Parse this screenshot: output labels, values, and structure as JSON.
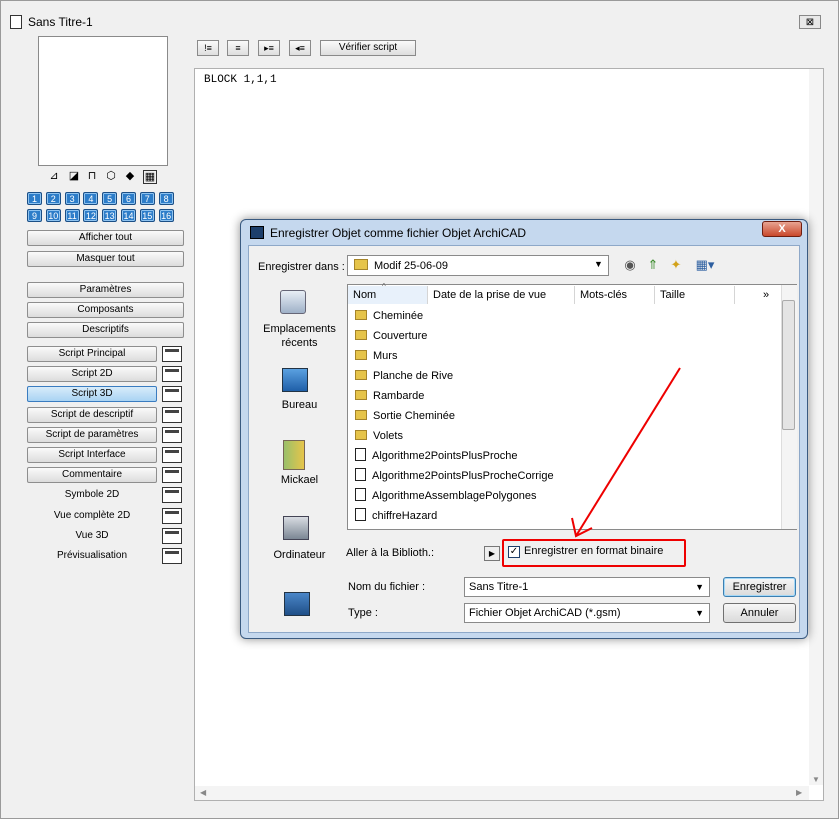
{
  "window": {
    "title": "Sans Titre-1",
    "close_label": "⊠"
  },
  "left_panel": {
    "view_icons": [
      "iso-view-icon",
      "plan-view-icon",
      "section-view-icon",
      "axo-view-icon",
      "perspective-view-icon",
      "film-view-icon"
    ],
    "number_buttons_row1": [
      "1",
      "2",
      "3",
      "4",
      "5",
      "6",
      "7",
      "8"
    ],
    "number_buttons_row2": [
      "9",
      "10",
      "11",
      "12",
      "13",
      "14",
      "15",
      "16"
    ],
    "show_all": "Afficher tout",
    "hide_all": "Masquer  tout",
    "params": "Paramètres",
    "components": "Composants",
    "descriptives": "Descriptifs",
    "scripts": [
      {
        "label": "Script Principal",
        "type": "button"
      },
      {
        "label": "Script 2D",
        "type": "button"
      },
      {
        "label": "Script 3D",
        "type": "button",
        "active": true
      },
      {
        "label": "Script de descriptif",
        "type": "button"
      },
      {
        "label": "Script de paramètres",
        "type": "button"
      },
      {
        "label": "Script Interface",
        "type": "button"
      },
      {
        "label": "Commentaire",
        "type": "button"
      },
      {
        "label": "Symbole 2D",
        "type": "label"
      },
      {
        "label": "Vue complète 2D",
        "type": "label"
      },
      {
        "label": "Vue 3D",
        "type": "label"
      },
      {
        "label": "Prévisualisation",
        "type": "label"
      }
    ]
  },
  "toolbar": {
    "verify_label": "Vérifier script"
  },
  "editor": {
    "code": "BLOCK 1,1,1"
  },
  "dialog": {
    "title": "Enregistrer Objet comme fichier Objet ArchiCAD",
    "close_label": "X",
    "save_in_label": "Enregistrer dans :",
    "save_in_value": "Modif 25-06-09",
    "places": [
      "Emplacements récents",
      "Bureau",
      "Mickael",
      "Ordinateur"
    ],
    "columns": [
      "Nom",
      "Date de la prise de vue",
      "Mots-clés",
      "Taille",
      "»"
    ],
    "files": [
      {
        "name": "Cheminée",
        "kind": "folder"
      },
      {
        "name": "Couverture",
        "kind": "folder"
      },
      {
        "name": "Murs",
        "kind": "folder"
      },
      {
        "name": "Planche de Rive",
        "kind": "folder"
      },
      {
        "name": "Rambarde",
        "kind": "folder"
      },
      {
        "name": "Sortie Cheminée",
        "kind": "folder"
      },
      {
        "name": "Volets",
        "kind": "folder"
      },
      {
        "name": "Algorithme2PointsPlusProche",
        "kind": "file"
      },
      {
        "name": "Algorithme2PointsPlusProcheCorrige",
        "kind": "file"
      },
      {
        "name": "AlgorithmeAssemblagePolygones",
        "kind": "file"
      },
      {
        "name": "chiffreHazard",
        "kind": "file"
      }
    ],
    "goto_label": "Aller à la Biblioth.:",
    "binary_checkbox_label": "Enregistrer en format binaire",
    "binary_checked": true,
    "filename_label": "Nom du fichier :",
    "filename_value": "Sans Titre-1",
    "type_label": "Type :",
    "type_value": "Fichier Objet ArchiCAD (*.gsm)",
    "save_button": "Enregistrer",
    "cancel_button": "Annuler"
  },
  "annotation": {
    "color": "#e00000"
  }
}
